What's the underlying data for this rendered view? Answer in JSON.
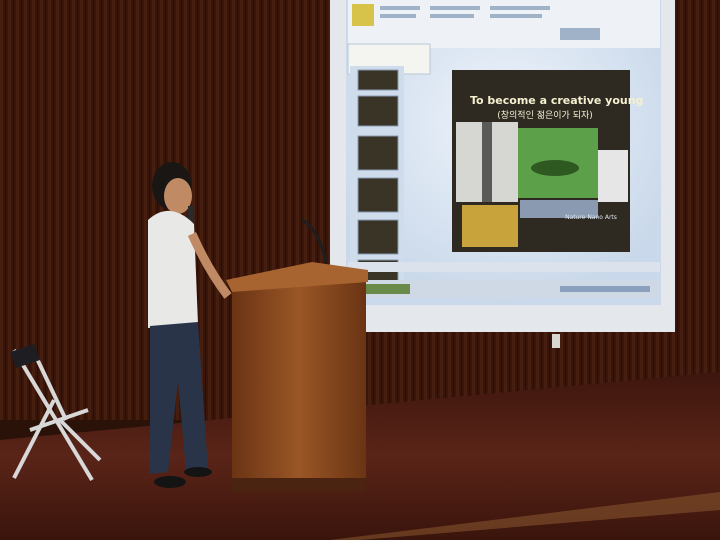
{
  "slide": {
    "title": "To become a creative young",
    "subtitle": "(창의적인 젊은이가 되자)",
    "caption": "Nature Nano Arts"
  },
  "colors": {
    "wall": "#4a1e10",
    "stage": "#4e1c12",
    "screen": "#dbe6f3",
    "slide_bg": "#2e2a22",
    "podium": "#8a4a22"
  }
}
